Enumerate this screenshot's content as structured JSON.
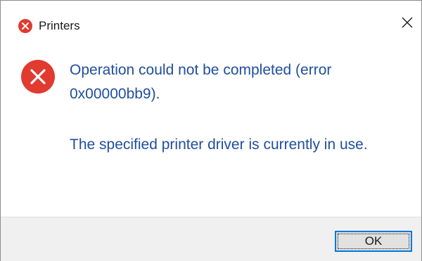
{
  "window": {
    "title": "Printers",
    "title_icon": "error-icon"
  },
  "titlebar": {
    "close_icon": "close-icon"
  },
  "message": {
    "icon": "error-icon",
    "line1": "Operation could not be completed (error 0x00000bb9).",
    "line2": "The specified printer driver is currently in use."
  },
  "footer": {
    "ok_label": "OK"
  },
  "colors": {
    "error_red": "#e13a2f",
    "message_text": "#1f4e9c",
    "footer_bg": "#f0f0f0",
    "focus_border": "#0078d7"
  }
}
